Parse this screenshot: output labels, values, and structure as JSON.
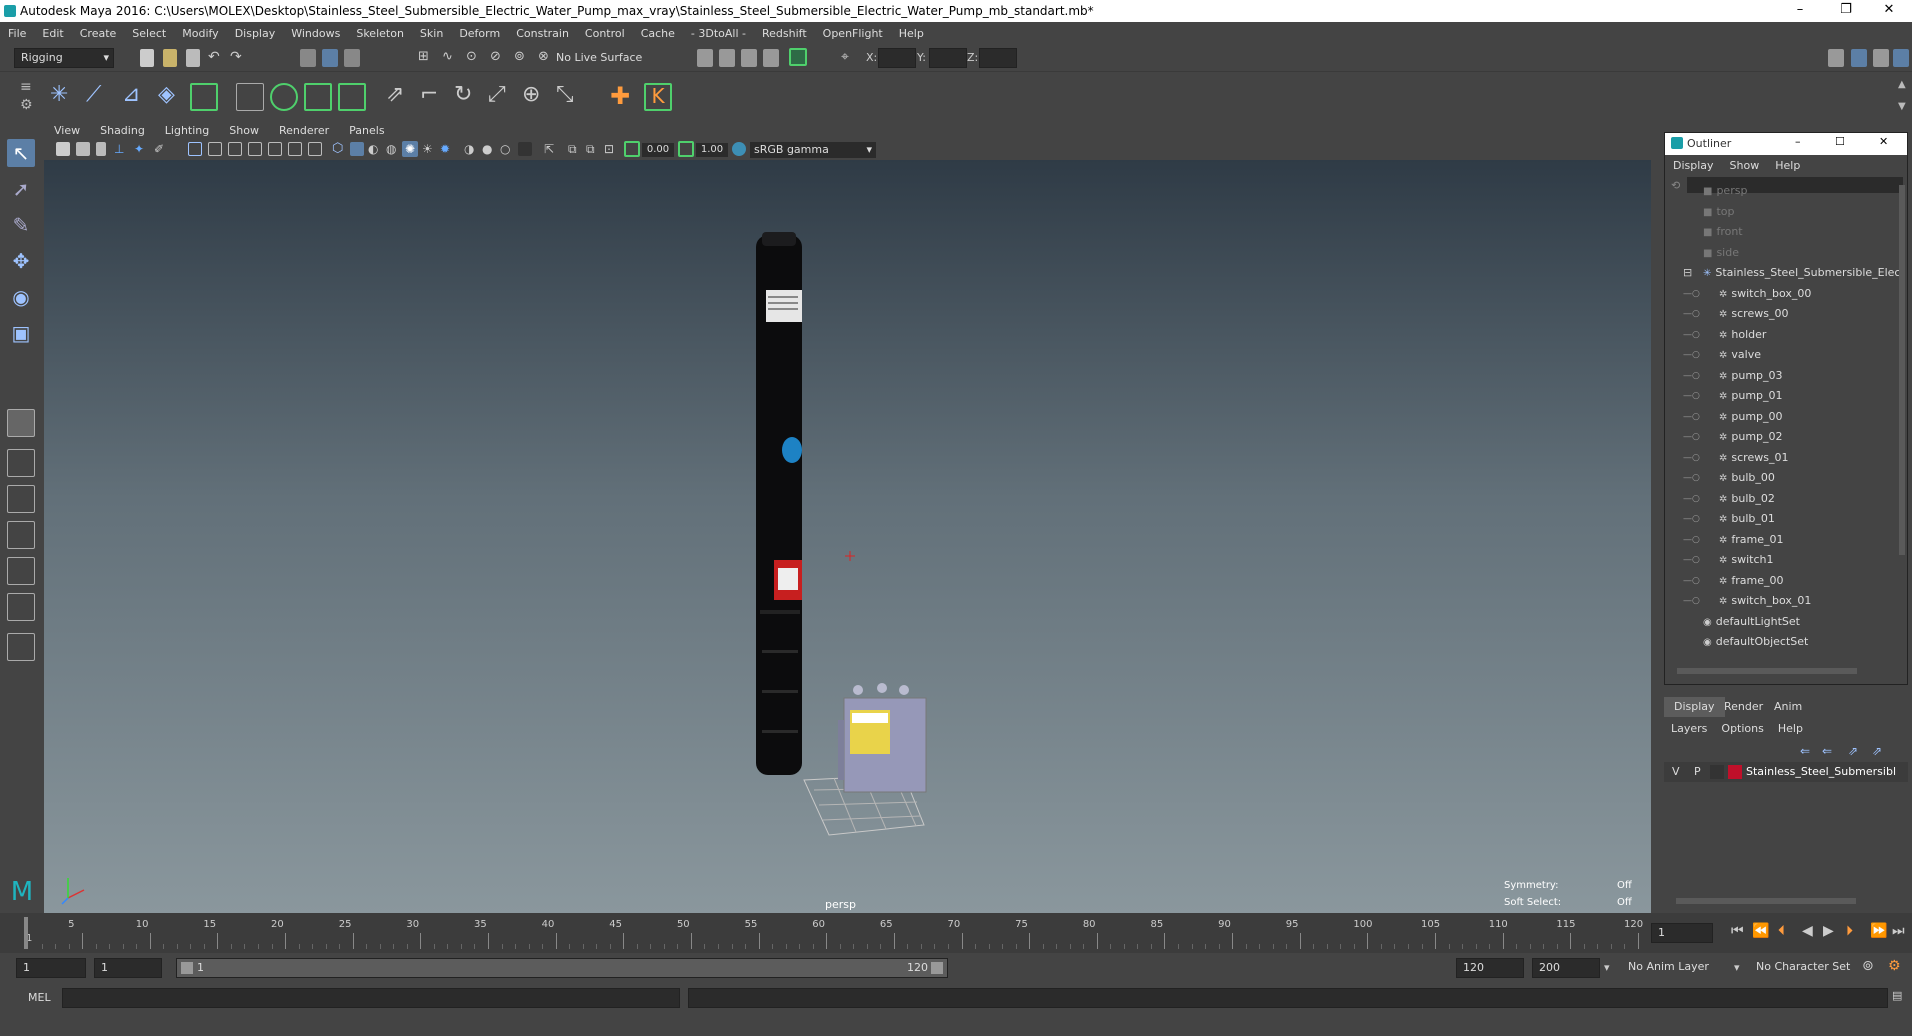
{
  "window": {
    "title": "Autodesk Maya 2016: C:\\Users\\MOLEX\\Desktop\\Stainless_Steel_Submersible_Electric_Water_Pump_max_vray\\Stainless_Steel_Submersible_Electric_Water_Pump_mb_standart.mb*",
    "minimize": "–",
    "restore": "❐",
    "close": "✕"
  },
  "menu": [
    "File",
    "Edit",
    "Create",
    "Select",
    "Modify",
    "Display",
    "Windows",
    "Skeleton",
    "Skin",
    "Deform",
    "Constrain",
    "Control",
    "Cache",
    "- 3DtoAll -",
    "Redshift",
    "OpenFlight",
    "Help"
  ],
  "status": {
    "mode": "Rigging",
    "live_surface": "No Live Surface",
    "x_label": "X:",
    "y_label": "Y:",
    "z_label": "Z:"
  },
  "viewport": {
    "menu": [
      "View",
      "Shading",
      "Lighting",
      "Show",
      "Renderer",
      "Panels"
    ],
    "exposure": "0.00",
    "gamma": "1.00",
    "color_space": "sRGB gamma",
    "camera_label": "persp",
    "symmetry_label": "Symmetry:",
    "symmetry_value": "Off",
    "soft_select_label": "Soft Select:",
    "soft_select_value": "Off"
  },
  "outliner": {
    "title": "Outliner",
    "menu": [
      "Display",
      "Show",
      "Help"
    ],
    "items": [
      {
        "label": "persp",
        "type": "camera"
      },
      {
        "label": "top",
        "type": "camera"
      },
      {
        "label": "front",
        "type": "camera"
      },
      {
        "label": "side",
        "type": "camera"
      },
      {
        "label": "Stainless_Steel_Submersible_Elec",
        "type": "group"
      },
      {
        "label": "switch_box_00",
        "type": "mesh"
      },
      {
        "label": "screws_00",
        "type": "mesh"
      },
      {
        "label": "holder",
        "type": "mesh"
      },
      {
        "label": "valve",
        "type": "mesh"
      },
      {
        "label": "pump_03",
        "type": "mesh"
      },
      {
        "label": "pump_01",
        "type": "mesh"
      },
      {
        "label": "pump_00",
        "type": "mesh"
      },
      {
        "label": "pump_02",
        "type": "mesh"
      },
      {
        "label": "screws_01",
        "type": "mesh"
      },
      {
        "label": "bulb_00",
        "type": "mesh"
      },
      {
        "label": "bulb_02",
        "type": "mesh"
      },
      {
        "label": "bulb_01",
        "type": "mesh"
      },
      {
        "label": "frame_01",
        "type": "mesh"
      },
      {
        "label": "switch1",
        "type": "mesh"
      },
      {
        "label": "frame_00",
        "type": "mesh"
      },
      {
        "label": "switch_box_01",
        "type": "mesh"
      },
      {
        "label": "defaultLightSet",
        "type": "set"
      },
      {
        "label": "defaultObjectSet",
        "type": "set"
      }
    ]
  },
  "layers": {
    "tabs": [
      "Display",
      "Render",
      "Anim"
    ],
    "menu": [
      "Layers",
      "Options",
      "Help"
    ],
    "row": {
      "v": "V",
      "p": "P",
      "name": "Stainless_Steel_Submersibl",
      "color": "#c0102a"
    }
  },
  "timeline": {
    "ticks": [
      "5",
      "10",
      "15",
      "20",
      "25",
      "30",
      "35",
      "40",
      "45",
      "50",
      "55",
      "60",
      "65",
      "70",
      "75",
      "80",
      "85",
      "90",
      "95",
      "100",
      "105",
      "110",
      "115",
      "120"
    ],
    "start_tick": "1",
    "current_frame": "1"
  },
  "range": {
    "start": "1",
    "playback_start": "1",
    "slider_start": "1",
    "slider_end": "120",
    "playback_end": "120",
    "end": "200",
    "anim_layer": "No Anim Layer",
    "character_set": "No Character Set"
  },
  "command": {
    "label": "MEL"
  }
}
